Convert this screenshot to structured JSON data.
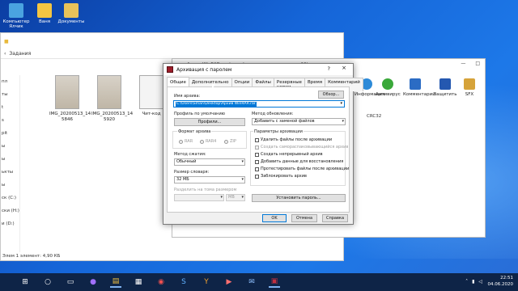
{
  "desktop": {
    "icons": [
      {
        "label": "Компьютер Ялчик",
        "color": "#4aa3e0"
      },
      {
        "label": "Ваня",
        "color": "#f4c542"
      },
      {
        "label": "Документы",
        "color": "#e8c25a"
      }
    ]
  },
  "explorer": {
    "title_label": "Задания",
    "nav": [
      "пл",
      "ты",
      "t",
      "s",
      "",
      "pit",
      "",
      "",
      "",
      "",
      "",
      "ы",
      "ы",
      "",
      "",
      "ькты",
      "ы",
      "ск (C:)",
      "ски (H:)",
      "и (D:)"
    ],
    "files": [
      {
        "name": "IMG_20200513_14 5846"
      },
      {
        "name": "IMG_20200513_14 5920"
      },
      {
        "name": "Чит-код"
      }
    ],
    "status": "Элем 1 элемент: 4,90 КБ"
  },
  "winrar": {
    "title": "Архив WinRAR.rar (ценой до покупки лицензию: 19)",
    "tools": [
      {
        "label": "Информация",
        "color": "#2d8ad8"
      },
      {
        "label": "Антивирус",
        "color": "#3aa83a"
      },
      {
        "label": "Комментарий",
        "color": "#2b6cc4"
      },
      {
        "label": "Защитить",
        "color": "#2458b0"
      },
      {
        "label": "SFX",
        "color": "#d6a33a"
      }
    ],
    "crc_header": "CRC32"
  },
  "dialog": {
    "title": "Архивация с паролем",
    "help": "?",
    "close": "×",
    "tabs": [
      "Общие",
      "Дополнительно",
      "Опции",
      "Файлы",
      "Резервные копии",
      "Время",
      "Комментарий"
    ],
    "archive_name_label": "Имя архива:",
    "archive_name_value": "C:\\Users\\Sman\\Desktop\\Архив WinRAR.rar",
    "browse_button": "Обзор...",
    "profile_label": "Профиль по умолчанию",
    "profiles_button": "Профили...",
    "update_method_label": "Метод обновления:",
    "update_method_value": "Добавить с заменой файлов",
    "format_label": "Формат архива",
    "formats": [
      "RAR",
      "RAR4",
      "ZIP"
    ],
    "compression_label": "Метод сжатия:",
    "compression_value": "Обычный",
    "dict_label": "Размер словаря:",
    "dict_value": "32 МБ",
    "split_label": "Разделить на тома размером",
    "split_unit": "MB",
    "params_label": "Параметры архивации",
    "params": [
      {
        "label": "Удалить файлы после архивации",
        "disabled": false
      },
      {
        "label": "Создать самораспаковывающийся архив",
        "disabled": true
      },
      {
        "label": "Создать непрерывный архив",
        "disabled": false
      },
      {
        "label": "Добавить данные для восстановления",
        "disabled": false
      },
      {
        "label": "Протестировать файлы после архивации",
        "disabled": false
      },
      {
        "label": "Заблокировать архив",
        "disabled": false
      }
    ],
    "set_password_button": "Установить пароль...",
    "ok_button": "OK",
    "cancel_button": "Отмена",
    "help_button": "Справка"
  },
  "taskbar": {
    "time": "22:51",
    "date": "04.06.2020"
  }
}
